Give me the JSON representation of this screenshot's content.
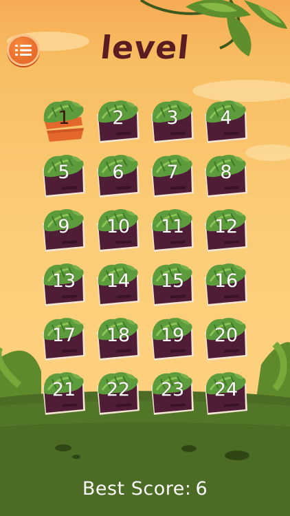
{
  "screen": {
    "title": "level",
    "best_score_label": "Best Score:",
    "best_score_value": "6"
  },
  "levels": [
    "1",
    "2",
    "3",
    "4",
    "5",
    "6",
    "7",
    "8",
    "9",
    "10",
    "11",
    "12",
    "13",
    "14",
    "15",
    "16",
    "17",
    "18",
    "19",
    "20",
    "21",
    "22",
    "23",
    "24"
  ],
  "selected_level": "1",
  "icons": {
    "menu": "list-menu-icon"
  },
  "colors": {
    "title": "#5a1e22",
    "board": "#4f1d35",
    "active_board": "#e4682c",
    "leaf": "#5c9c3c",
    "ground": "#4c6b24"
  }
}
